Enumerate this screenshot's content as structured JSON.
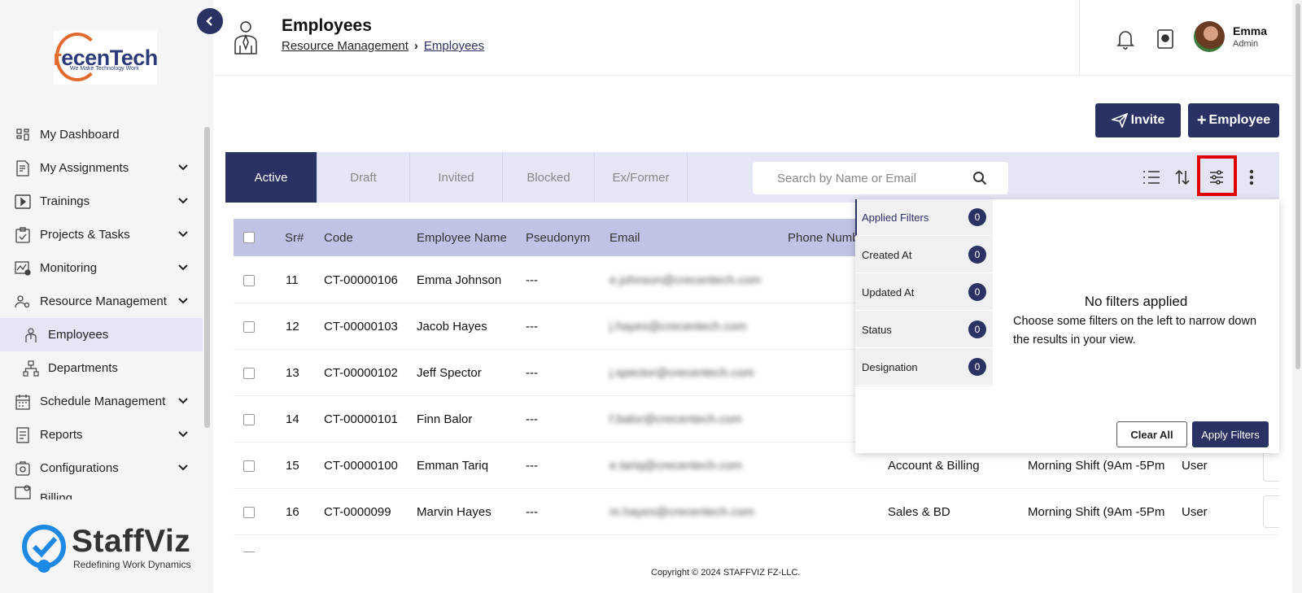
{
  "sidebar": {
    "logo": {
      "brand": "recenTech",
      "tagline": "We Make Technology Work"
    },
    "items": [
      {
        "label": "My Dashboard",
        "icon": "dashboard-icon",
        "expandable": false
      },
      {
        "label": "My Assignments",
        "icon": "assignments-icon",
        "expandable": true
      },
      {
        "label": "Trainings",
        "icon": "play-icon",
        "expandable": true
      },
      {
        "label": "Projects & Tasks",
        "icon": "clipboard-icon",
        "expandable": true
      },
      {
        "label": "Monitoring",
        "icon": "monitoring-icon",
        "expandable": true
      },
      {
        "label": "Resource Management",
        "icon": "people-gear-icon",
        "expandable": true
      },
      {
        "label": "Employees",
        "icon": "employee-icon",
        "sub": true,
        "active": true
      },
      {
        "label": "Departments",
        "icon": "org-chart-icon",
        "sub": true
      },
      {
        "label": "Schedule Management",
        "icon": "calendar-icon",
        "expandable": true
      },
      {
        "label": "Reports",
        "icon": "report-icon",
        "expandable": true
      },
      {
        "label": "Configurations",
        "icon": "config-icon",
        "expandable": true
      },
      {
        "label": "Billing",
        "icon": "billing-icon",
        "expandable": true
      }
    ],
    "footer_brand": {
      "name": "StaffViz",
      "tagline": "Redefining Work Dynamics"
    }
  },
  "header": {
    "title": "Employees",
    "breadcrumb": [
      "Resource Management",
      "Employees"
    ],
    "user": {
      "name": "Emma",
      "role": "Admin"
    }
  },
  "actions": {
    "invite": "Invite",
    "add_employee": "Employee"
  },
  "tabs": [
    "Active",
    "Draft",
    "Invited",
    "Blocked",
    "Ex/Former"
  ],
  "search": {
    "placeholder": "Search by Name or Email"
  },
  "table": {
    "columns": [
      "Sr#",
      "Code",
      "Employee Name",
      "Pseudonym",
      "Email",
      "Phone Numb"
    ],
    "rows": [
      {
        "sr": "11",
        "code": "CT-00000106",
        "name": "Emma Johnson",
        "pseudonym": "---",
        "email": "e.johnson@crecentech.com",
        "department": "",
        "shift": "",
        "role": ""
      },
      {
        "sr": "12",
        "code": "CT-00000103",
        "name": "Jacob Hayes",
        "pseudonym": "---",
        "email": "j.hayes@crecentech.com",
        "department": "",
        "shift": "",
        "role": ""
      },
      {
        "sr": "13",
        "code": "CT-00000102",
        "name": "Jeff Spector",
        "pseudonym": "---",
        "email": "j.spector@crecentech.com",
        "department": "",
        "shift": "",
        "role": ""
      },
      {
        "sr": "14",
        "code": "CT-00000101",
        "name": "Finn Balor",
        "pseudonym": "---",
        "email": "f.balor@crecentech.com",
        "department": "",
        "shift": "",
        "role": ""
      },
      {
        "sr": "15",
        "code": "CT-00000100",
        "name": "Emman Tariq",
        "pseudonym": "---",
        "email": "e.tariq@crecentech.com",
        "department": "Account & Billing",
        "shift": "Morning Shift (9Am -5Pm",
        "role": "User"
      },
      {
        "sr": "16",
        "code": "CT-0000099",
        "name": "Marvin Hayes",
        "pseudonym": "---",
        "email": "m.hayes@crecentech.com",
        "department": "Sales & BD",
        "shift": "Morning Shift (9Am -5Pm",
        "role": "User"
      }
    ]
  },
  "filters": {
    "items": [
      {
        "label": "Applied Filters",
        "count": "0"
      },
      {
        "label": "Created At",
        "count": "0"
      },
      {
        "label": "Updated At",
        "count": "0"
      },
      {
        "label": "Status",
        "count": "0"
      },
      {
        "label": "Designation",
        "count": "0"
      }
    ],
    "empty_title": "No filters applied",
    "empty_desc": "Choose some filters on the left to narrow down the results in your view.",
    "clear_label": "Clear All",
    "apply_label": "Apply Filters"
  },
  "footer": {
    "copyright": "Copyright © 2024 STAFFVIZ FZ-LLC."
  },
  "colors": {
    "primary": "#2a3163",
    "tab_bg": "#e4e5f5",
    "table_header": "#c1c3e6",
    "highlight": "#e00000",
    "logo_accent": "#e36a2e"
  }
}
